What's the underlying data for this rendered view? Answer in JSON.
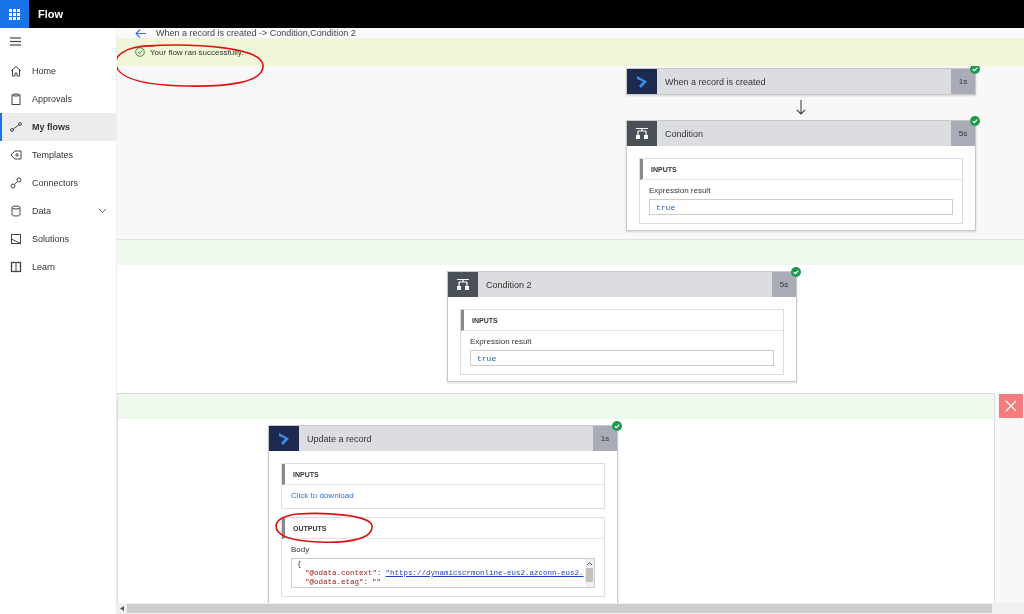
{
  "app": {
    "title": "Flow"
  },
  "sidebar": {
    "items": [
      {
        "label": "Home",
        "selected": false
      },
      {
        "label": "Approvals",
        "selected": false
      },
      {
        "label": "My flows",
        "selected": true
      },
      {
        "label": "Templates",
        "selected": false
      },
      {
        "label": "Connectors",
        "selected": false
      },
      {
        "label": "Data",
        "selected": false,
        "expandable": true
      },
      {
        "label": "Solutions",
        "selected": false
      },
      {
        "label": "Learn",
        "selected": false
      }
    ]
  },
  "breadcrumb": {
    "title": "When a record is created -> Condition,Condition 2"
  },
  "banner": {
    "message": "Your flow ran successfully.",
    "circled": true
  },
  "scopes": [
    {
      "kind": "plain",
      "cards": [
        {
          "title": "When a record is created",
          "duration": "1s",
          "kind": "action",
          "succeeded": true
        },
        {
          "title": "Condition",
          "duration": "5s",
          "kind": "condition",
          "succeeded": true,
          "sections": [
            {
              "heading": "INPUTS",
              "kind": "expression",
              "label": "Expression result",
              "value": "true"
            }
          ]
        }
      ]
    },
    {
      "kind": "branch",
      "cards": [
        {
          "title": "Condition 2",
          "duration": "5s",
          "kind": "condition",
          "succeeded": true,
          "sections": [
            {
              "heading": "INPUTS",
              "kind": "expression",
              "label": "Expression result",
              "value": "true"
            }
          ]
        }
      ]
    },
    {
      "kind": "branch",
      "closable": true,
      "cards": [
        {
          "title": "Update a record",
          "duration": "1s",
          "kind": "action",
          "succeeded": true,
          "sections": [
            {
              "heading": "INPUTS",
              "kind": "link",
              "value": "Click to download"
            },
            {
              "heading": "OUTPUTS",
              "kind": "code",
              "circled": true,
              "label": "Body",
              "lines": [
                {
                  "text": "{"
                },
                {
                  "key": "\"@odata.context\":",
                  "value": "\"https://dynamicscrmonline-eus2.azconn-eus2.",
                  "link": true
                },
                {
                  "key": "\"@odata.etag\":",
                  "value": "\"\"",
                  "link": false
                }
              ]
            }
          ]
        }
      ]
    }
  ]
}
